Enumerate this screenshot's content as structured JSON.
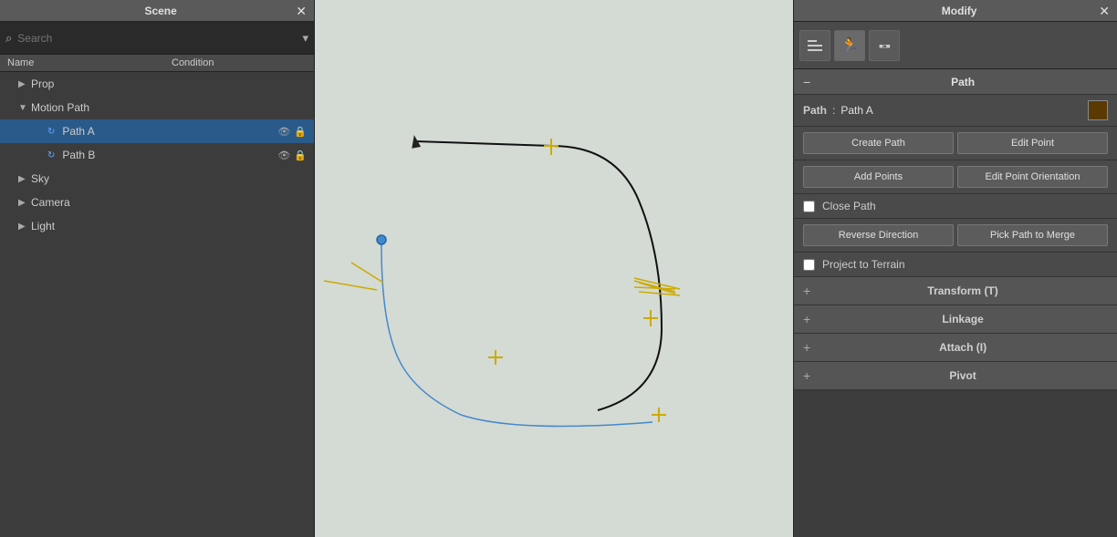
{
  "scene_panel": {
    "title": "Scene",
    "search": {
      "placeholder": "Search",
      "value": ""
    },
    "tree_headers": {
      "name": "Name",
      "condition": "Condition"
    },
    "tree_items": [
      {
        "id": "prop",
        "label": "Prop",
        "indent": 1,
        "type": "group",
        "expanded": false,
        "icons": []
      },
      {
        "id": "motion-path",
        "label": "Motion Path",
        "indent": 1,
        "type": "group",
        "expanded": true,
        "icons": []
      },
      {
        "id": "path-a",
        "label": "Path A",
        "indent": 3,
        "type": "item",
        "selected": true,
        "icons": [
          "eye",
          "lock"
        ]
      },
      {
        "id": "path-b",
        "label": "Path B",
        "indent": 3,
        "type": "item",
        "selected": false,
        "icons": [
          "eye",
          "lock"
        ]
      },
      {
        "id": "sky",
        "label": "Sky",
        "indent": 1,
        "type": "group",
        "expanded": false,
        "icons": []
      },
      {
        "id": "camera",
        "label": "Camera",
        "indent": 1,
        "type": "group",
        "expanded": false,
        "icons": []
      },
      {
        "id": "light",
        "label": "Light",
        "indent": 1,
        "type": "group",
        "expanded": false,
        "icons": []
      }
    ]
  },
  "modify_panel": {
    "title": "Modify",
    "path_section": {
      "label": "Path",
      "path_label": "Path",
      "path_value": "Path A",
      "color": "#5a3a00"
    },
    "buttons": {
      "create_path": "Create Path",
      "edit_point": "Edit Point",
      "add_points": "Add Points",
      "edit_point_orientation": "Edit Point Orientation",
      "reverse_direction": "Reverse Direction",
      "pick_path_to_merge": "Pick Path to Merge"
    },
    "close_path_label": "Close Path",
    "project_to_terrain_label": "Project to Terrain",
    "collapsible_sections": [
      {
        "label": "Transform  (T)"
      },
      {
        "label": "Linkage"
      },
      {
        "label": "Attach  (I)"
      },
      {
        "label": "Pivot"
      }
    ]
  },
  "icons": {
    "close": "✕",
    "search": "🔍",
    "dropdown": "▾",
    "arrow_right": "▶",
    "arrow_down": "▼",
    "eye": "👁",
    "lock": "🔒",
    "plus": "+",
    "minus": "−"
  }
}
